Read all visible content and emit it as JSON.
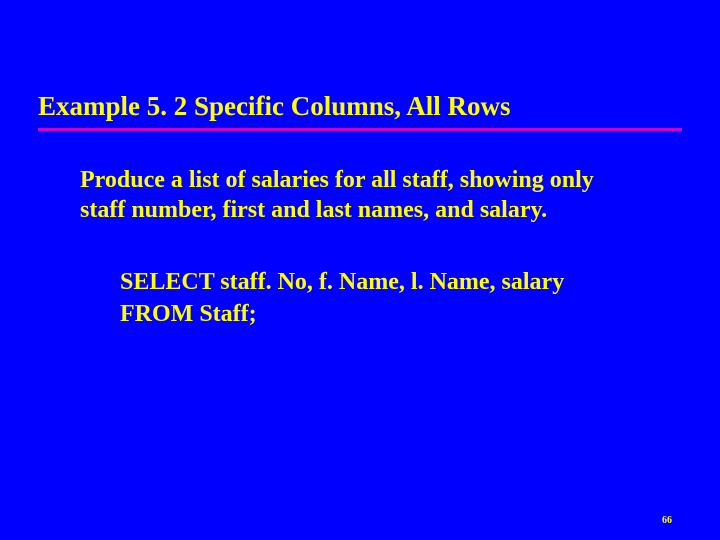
{
  "slide": {
    "title": "Example 5. 2  Specific Columns, All Rows",
    "description": "Produce a list of salaries for all staff, showing only staff number, first and last names, and salary.",
    "code": {
      "line1": "SELECT staff. No, f. Name, l. Name, salary",
      "line2": "FROM Staff;"
    },
    "page_number": "66"
  },
  "colors": {
    "background": "#0000ff",
    "text": "#ffff00",
    "underline": "#cc00cc"
  }
}
